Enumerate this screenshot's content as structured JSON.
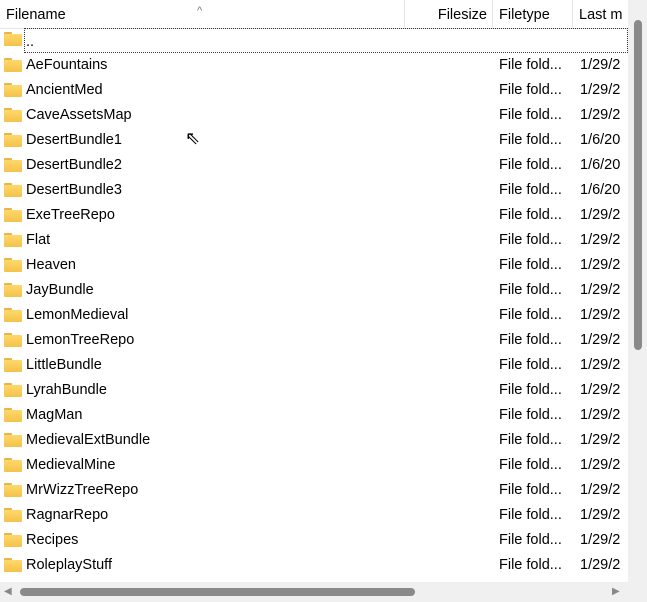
{
  "columns": {
    "filename": "Filename",
    "filesize": "Filesize",
    "filetype": "Filetype",
    "last_modified": "Last m"
  },
  "parent_dir": "..",
  "rows": [
    {
      "name": "AeFountains",
      "type": "File fold...",
      "date": "1/29/2"
    },
    {
      "name": "AncientMed",
      "type": "File fold...",
      "date": "1/29/2"
    },
    {
      "name": "CaveAssetsMap",
      "type": "File fold...",
      "date": "1/29/2"
    },
    {
      "name": "DesertBundle1",
      "type": "File fold...",
      "date": "1/6/20"
    },
    {
      "name": "DesertBundle2",
      "type": "File fold...",
      "date": "1/6/20"
    },
    {
      "name": "DesertBundle3",
      "type": "File fold...",
      "date": "1/6/20"
    },
    {
      "name": "ExeTreeRepo",
      "type": "File fold...",
      "date": "1/29/2"
    },
    {
      "name": "Flat",
      "type": "File fold...",
      "date": "1/29/2"
    },
    {
      "name": "Heaven",
      "type": "File fold...",
      "date": "1/29/2"
    },
    {
      "name": "JayBundle",
      "type": "File fold...",
      "date": "1/29/2"
    },
    {
      "name": "LemonMedieval",
      "type": "File fold...",
      "date": "1/29/2"
    },
    {
      "name": "LemonTreeRepo",
      "type": "File fold...",
      "date": "1/29/2"
    },
    {
      "name": "LittleBundle",
      "type": "File fold...",
      "date": "1/29/2"
    },
    {
      "name": "LyrahBundle",
      "type": "File fold...",
      "date": "1/29/2"
    },
    {
      "name": "MagMan",
      "type": "File fold...",
      "date": "1/29/2"
    },
    {
      "name": "MedievalExtBundle",
      "type": "File fold...",
      "date": "1/29/2"
    },
    {
      "name": "MedievalMine",
      "type": "File fold...",
      "date": "1/29/2"
    },
    {
      "name": "MrWizzTreeRepo",
      "type": "File fold...",
      "date": "1/29/2"
    },
    {
      "name": "RagnarRepo",
      "type": "File fold...",
      "date": "1/29/2"
    },
    {
      "name": "Recipes",
      "type": "File fold...",
      "date": "1/29/2"
    },
    {
      "name": "RoleplayStuff",
      "type": "File fold...",
      "date": "1/29/2"
    }
  ]
}
